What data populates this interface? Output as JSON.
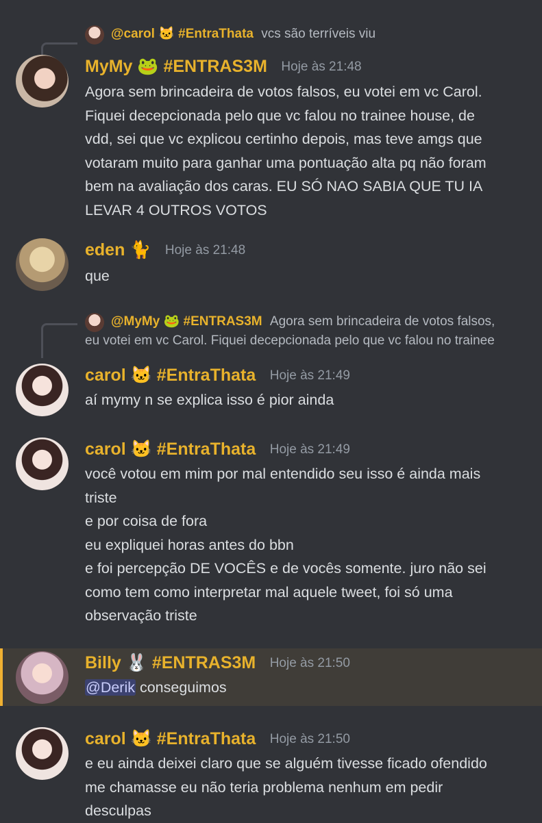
{
  "messages": [
    {
      "reply": {
        "name": "@carol 🐱 #EntraThata",
        "text": "vcs são terríveis viu"
      },
      "author": "MyMy 🐸 #ENTRAS3M",
      "time": "Hoje às 21:48",
      "lines": [
        "Agora sem brincadeira de votos falsos, eu votei em vc Carol.",
        "Fiquei decepcionada pelo que vc falou no trainee house, de",
        "vdd, sei que vc explicou certinho depois, mas teve amgs que",
        "votaram muito para ganhar uma pontuação alta pq não foram",
        "bem na avaliação dos caras. EU SÓ NAO SABIA QUE TU IA",
        "LEVAR 4 OUTROS VOTOS"
      ]
    },
    {
      "author": "eden 🐈",
      "time": "Hoje às 21:48",
      "lines": [
        "que"
      ]
    },
    {
      "reply": {
        "name": "@MyMy 🐸 #ENTRAS3M",
        "text": "Agora sem brincadeira de votos falsos,",
        "text2": "eu votei em vc Carol. Fiquei decepcionada pelo que vc falou no trainee"
      },
      "author": "carol 🐱 #EntraThata",
      "time": "Hoje às 21:49",
      "lines": [
        "aí mymy n se explica isso é pior ainda"
      ]
    },
    {
      "author": "carol 🐱 #EntraThata",
      "time": "Hoje às 21:49",
      "lines": [
        "você votou em mim por mal entendido seu isso é ainda mais",
        "triste",
        "e por coisa de fora",
        "eu expliquei horas antes do bbn",
        "e foi percepção DE VOCÊS e de vocês somente. juro não sei",
        "como tem como interpretar mal aquele tweet, foi só uma",
        "observação triste"
      ]
    },
    {
      "author": "Billy 🐰 #ENTRAS3M",
      "time": "Hoje às 21:50",
      "mention": "@Derik",
      "text_after_mention": " conseguimos"
    },
    {
      "author": "carol 🐱 #EntraThata",
      "time": "Hoje às 21:50",
      "lines": [
        "e eu ainda deixei claro que se alguém tivesse ficado ofendido",
        "me chamasse eu não teria problema nenhum em pedir",
        "desculpas"
      ]
    }
  ],
  "colors": {
    "background": "#313338",
    "username": "#e8b22c",
    "text": "#dbdee1",
    "timestamp": "#949ba4",
    "highlight_bar": "#f0b132",
    "mention_bg": "#3c4270"
  }
}
